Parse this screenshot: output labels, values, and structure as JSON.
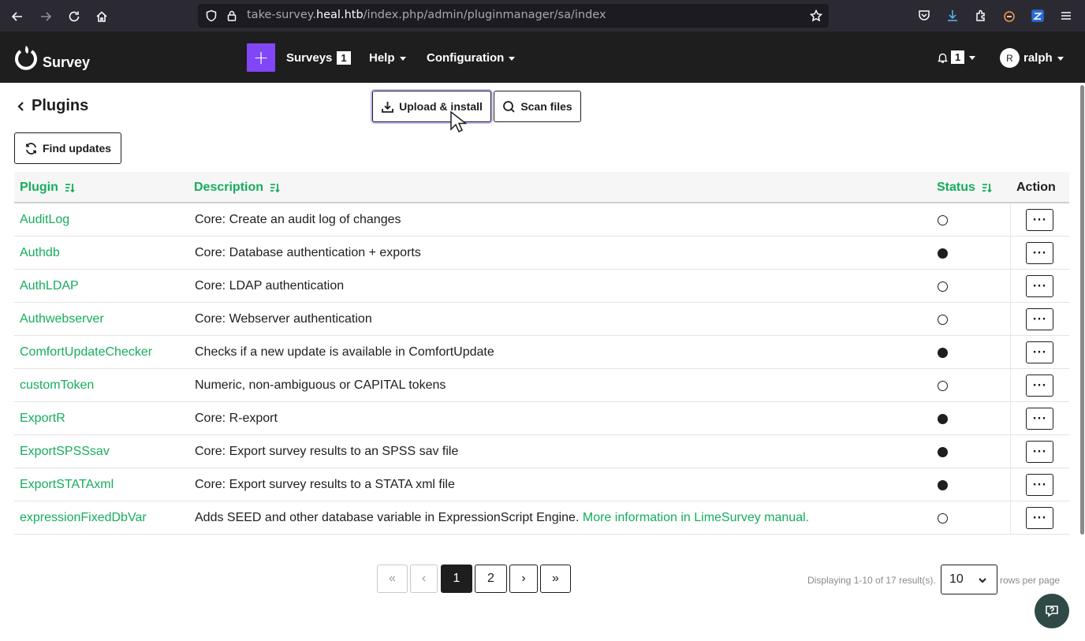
{
  "browser": {
    "url_prefix": "take-survey.",
    "url_host": "heal.htb",
    "url_path": "/index.php/admin/pluginmanager/sa/index"
  },
  "app": {
    "logo_text": "Survey",
    "create_label": "+",
    "nav": {
      "surveys_label": "Surveys",
      "surveys_count": "1",
      "help_label": "Help",
      "configuration_label": "Configuration",
      "notifications_count": "1",
      "user_initial": "R",
      "user_name": "ralph"
    }
  },
  "page": {
    "title": "Plugins",
    "upload_button": "Upload & install",
    "scan_button": "Scan files",
    "find_updates_button": "Find updates"
  },
  "table": {
    "headers": {
      "plugin": "Plugin",
      "description": "Description",
      "status": "Status",
      "action": "Action"
    },
    "rows": [
      {
        "name": "AuditLog",
        "description": "Core: Create an audit log of changes",
        "more": "",
        "active": false
      },
      {
        "name": "Authdb",
        "description": "Core: Database authentication + exports",
        "more": "",
        "active": true
      },
      {
        "name": "AuthLDAP",
        "description": "Core: LDAP authentication",
        "more": "",
        "active": false
      },
      {
        "name": "Authwebserver",
        "description": "Core: Webserver authentication",
        "more": "",
        "active": false
      },
      {
        "name": "ComfortUpdateChecker",
        "description": "Checks if a new update is available in ComfortUpdate",
        "more": "",
        "active": true
      },
      {
        "name": "customToken",
        "description": "Numeric, non-ambiguous or CAPITAL tokens",
        "more": "",
        "active": false
      },
      {
        "name": "ExportR",
        "description": "Core: R-export",
        "more": "",
        "active": true
      },
      {
        "name": "ExportSPSSsav",
        "description": "Core: Export survey results to an SPSS sav file",
        "more": "",
        "active": true
      },
      {
        "name": "ExportSTATAxml",
        "description": "Core: Export survey results to a STATA xml file",
        "more": "",
        "active": true
      },
      {
        "name": "expressionFixedDbVar",
        "description": "Adds SEED and other database variable in ExpressionScript Engine.",
        "more": "More information in LimeSurvey manual.",
        "active": false
      }
    ],
    "row_action_label": "···"
  },
  "pagination": {
    "first": "«",
    "prev": "‹",
    "pages": [
      "1",
      "2"
    ],
    "current_page": "1",
    "next": "›",
    "last": "»",
    "summary": "Displaying 1-10 of 17 result(s).",
    "rows_per_page_value": "10",
    "rows_per_page_label": "rows per page"
  },
  "colors": {
    "accent_green": "#14ae5c",
    "create_purple": "#8146f6",
    "navbar_dark": "#1e1e1e"
  }
}
